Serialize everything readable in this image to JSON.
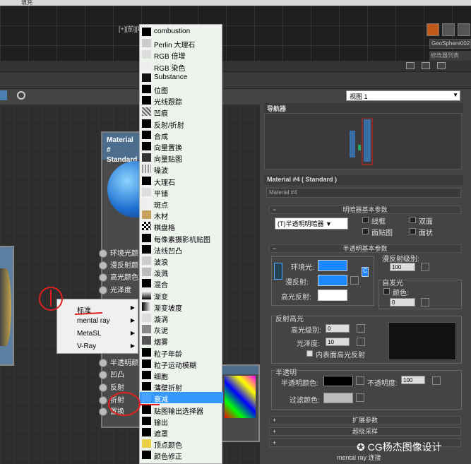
{
  "topbar": {
    "label": "填充"
  },
  "viewport": {
    "label": "[+][前][线"
  },
  "objects": {
    "geo_name": "GeoSphere002",
    "geo_sub": "修改器列表"
  },
  "view_select": "视图 1",
  "node": {
    "title_line1": "Material #",
    "title_line2": "Standard",
    "slots": [
      "环境光颜",
      "漫反射颜",
      "高光颜色",
      "光泽度",
      "半透明颜",
      "凹凸",
      "反射",
      "折射",
      "置换"
    ]
  },
  "context_menu": [
    {
      "label": "标准"
    },
    {
      "label": "mental ray"
    },
    {
      "label": "MetaSL"
    },
    {
      "label": "V-Ray"
    }
  ],
  "map_list": [
    "combustion",
    "Perlin 大理石",
    "RGB 倍增",
    "RGB 染色",
    "Substance",
    "位图",
    "光线跟踪",
    "凹痕",
    "反射/折射",
    "合成",
    "向量置换",
    "向量贴图",
    "噪波",
    "大理石",
    "平铺",
    "斑点",
    "木材",
    "棋盘格",
    "每像素摄影机贴图",
    "法线凹凸",
    "波浪",
    "泼溅",
    "混合",
    "渐变",
    "渐变坡度",
    "漩涡",
    "灰泥",
    "烟雾",
    "粒子年龄",
    "粒子运动模糊",
    "细胞",
    "薄壁折射",
    "衰减",
    "贴图输出选择器",
    "输出",
    "遮罩",
    "顶点颜色",
    "颜色修正"
  ],
  "map_selected": "衰减",
  "right": {
    "navigator": "导航器",
    "material_title": "Material #4 ( Standard )",
    "material_name": "Material #4",
    "shader_rollout": "明暗器基本参数",
    "shader_type": "(T)半透明明暗器",
    "shader_opts": [
      "线框",
      "双面",
      "面贴图",
      "面状"
    ],
    "basic_rollout": "半透明基本参数",
    "ambient": "环境光:",
    "diffuse": "漫反射:",
    "specular": "高光反射:",
    "diffuse_level_label": "漫反射级别:",
    "diffuse_level": "100",
    "self_illum": "自发光",
    "color_label": "颜色:",
    "self_illum_val": "0",
    "spec_group": "反射高光",
    "spec_level_label": "高光级别:",
    "spec_level": "0",
    "gloss_label": "光泽度:",
    "gloss": "10",
    "backside": "内表面高光反射",
    "trans_group": "半透明",
    "trans_color": "半透明颜色:",
    "opacity_label": "不透明度:",
    "opacity": "100",
    "filter_color": "过滤颜色:",
    "ext_rollout": "扩展参数",
    "super_rollout": "超级采样",
    "mr_rollout": "mental ray 连接"
  },
  "watermark": "CG杨杰图像设计",
  "colors": {
    "blue": "#1e88ff",
    "selection": "#3399ff"
  }
}
